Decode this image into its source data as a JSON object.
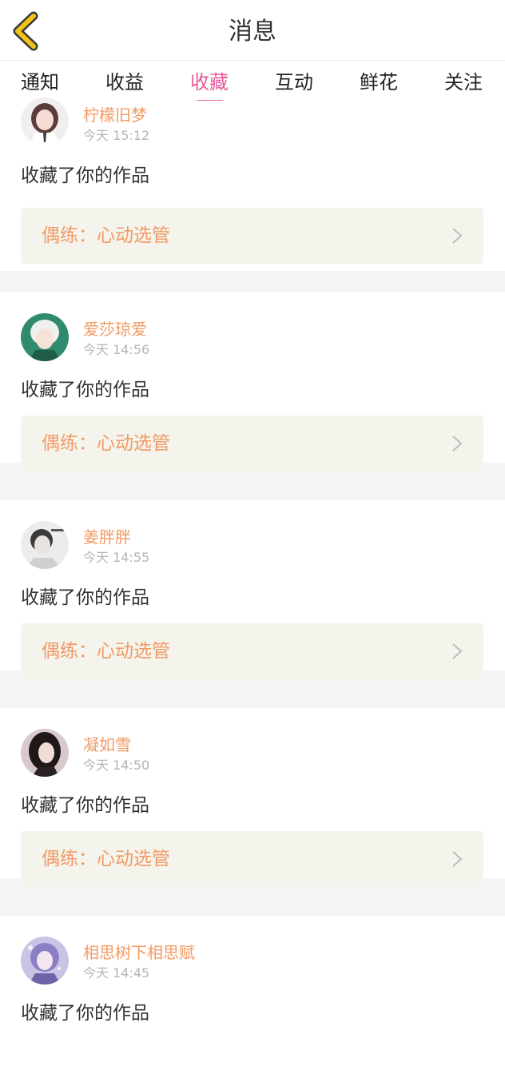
{
  "header": {
    "title": "消息",
    "back_icon": "chevron-left-icon",
    "back_color": "#f0c419"
  },
  "tabs": [
    {
      "label": "通知",
      "active": false
    },
    {
      "label": "收益",
      "active": false
    },
    {
      "label": "收藏",
      "active": true
    },
    {
      "label": "互动",
      "active": false
    },
    {
      "label": "鲜花",
      "active": false
    },
    {
      "label": "关注",
      "active": false
    }
  ],
  "colors": {
    "accent": "#e45c9b",
    "username": "#f29a64",
    "work_bg": "#f4f4ec"
  },
  "messages": [
    {
      "username": "柠檬旧梦",
      "time": "今天 15:12",
      "action": "收藏了你的作品",
      "work": "偶练：心动选管"
    },
    {
      "username": "爱莎琼爱",
      "time": "今天 14:56",
      "action": "收藏了你的作品",
      "work": "偶练：心动选管"
    },
    {
      "username": "姜胖胖",
      "time": "今天 14:55",
      "action": "收藏了你的作品",
      "work": "偶练：心动选管"
    },
    {
      "username": "凝如雪",
      "time": "今天 14:50",
      "action": "收藏了你的作品",
      "work": "偶练：心动选管"
    },
    {
      "username": "相思树下相思赋",
      "time": "今天 14:45",
      "action": "收藏了你的作品",
      "work": ""
    }
  ]
}
